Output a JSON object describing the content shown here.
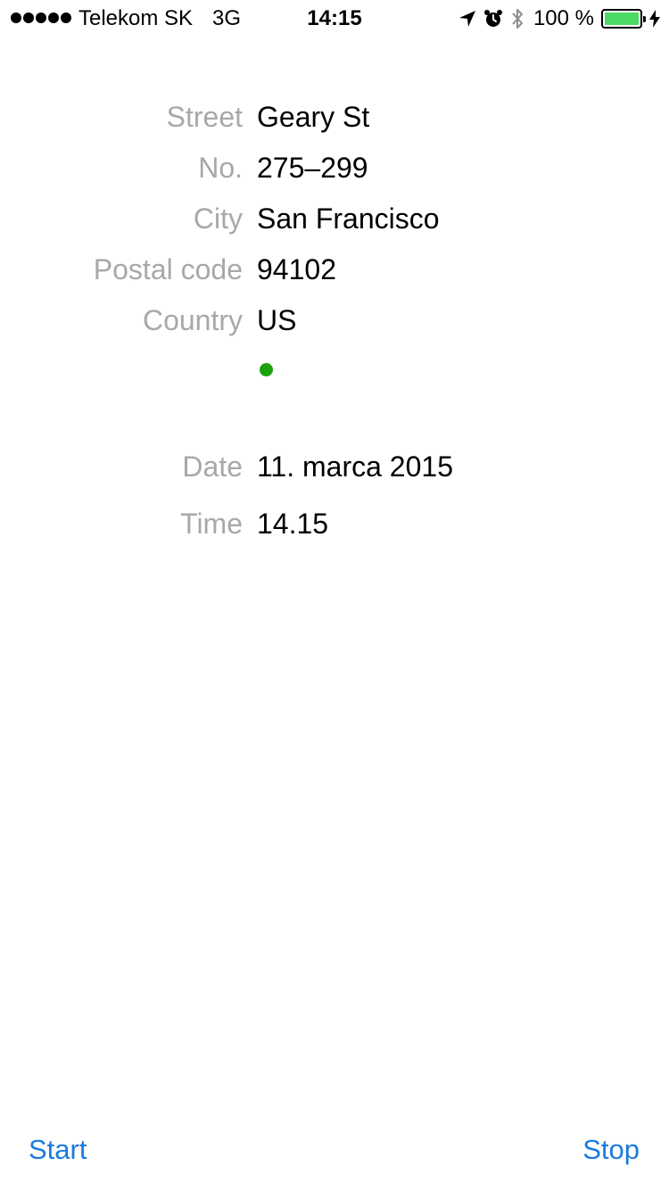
{
  "status_bar": {
    "carrier": "Telekom SK",
    "network": "3G",
    "time": "14:15",
    "battery_percent": "100 %",
    "battery_level": 1.0,
    "signal_bars": 5,
    "icons": [
      "location-arrow-icon",
      "alarm-clock-icon",
      "bluetooth-icon",
      "battery-icon",
      "charging-bolt-icon"
    ],
    "battery_color": "#4cd964"
  },
  "address": {
    "street_label": "Street",
    "street_value": "Geary St",
    "number_label": "No.",
    "number_value": "275–299",
    "city_label": "City",
    "city_value": "San Francisco",
    "postal_label": "Postal code",
    "postal_value": "94102",
    "country_label": "Country",
    "country_value": "US",
    "status_dot_color": "#1aa10e"
  },
  "timestamp": {
    "date_label": "Date",
    "date_value": "11. marca 2015",
    "time_label": "Time",
    "time_value": "14.15"
  },
  "toolbar": {
    "start_label": "Start",
    "stop_label": "Stop",
    "tint_color": "#1a7be0"
  }
}
